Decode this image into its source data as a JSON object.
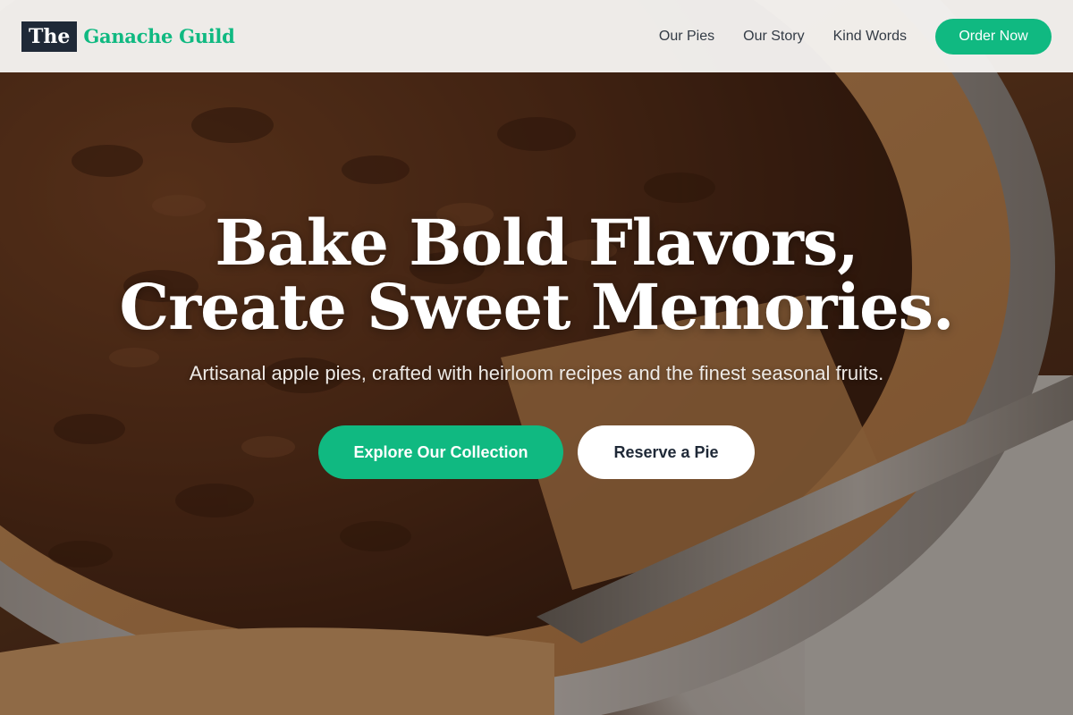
{
  "header": {
    "logo": {
      "box_text": "The",
      "name": "Ganache Guild"
    },
    "nav": {
      "items": [
        {
          "label": "Our Pies"
        },
        {
          "label": "Our Story"
        },
        {
          "label": "Kind Words"
        }
      ],
      "cta_label": "Order Now"
    }
  },
  "hero": {
    "title_line_1": "Bake Bold Flavors,",
    "title_line_2": "Create Sweet Memories.",
    "subtitle": "Artisanal apple pies, crafted with heirloom recipes and the finest seasonal fruits.",
    "primary_button": "Explore Our Collection",
    "secondary_button": "Reserve a Pie",
    "background_image": "pecan-pie-photo"
  },
  "colors": {
    "accent": "#10b981",
    "dark": "#1f2937",
    "header_bg": "#f4f2f0",
    "hero_text": "#ffffff"
  }
}
